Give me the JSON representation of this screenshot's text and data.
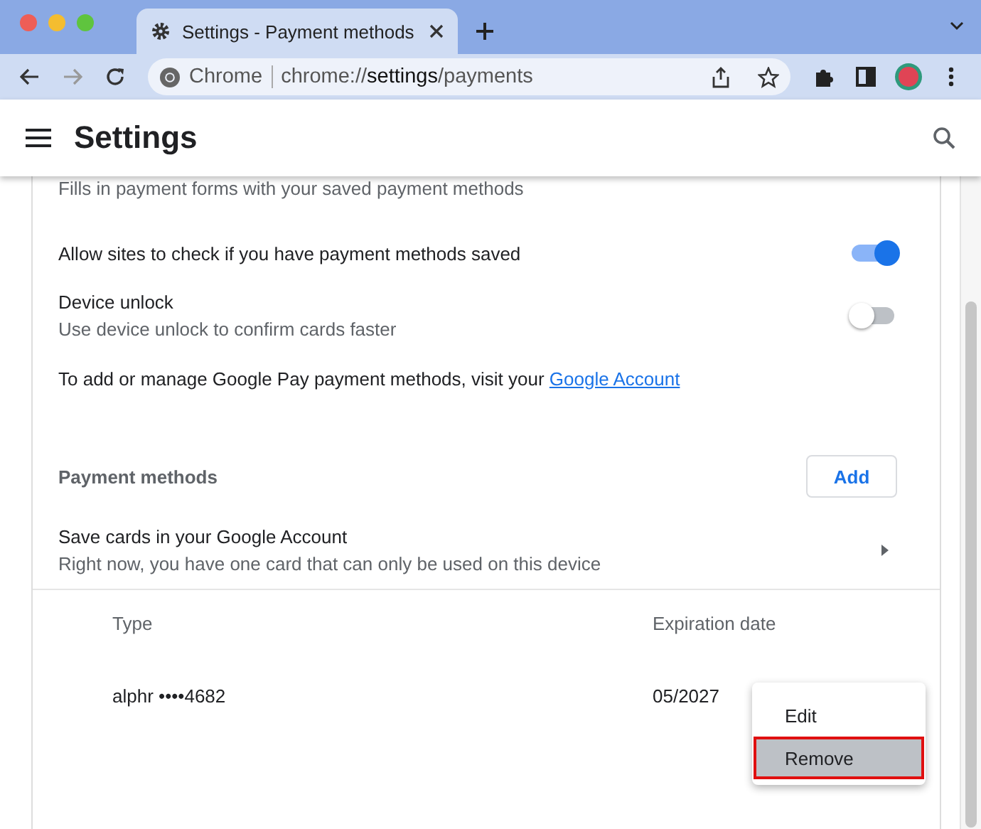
{
  "browser": {
    "tab_title": "Settings - Payment methods",
    "omnibox_label": "Chrome",
    "url_prefix": "chrome://",
    "url_host": "settings",
    "url_path": "/payments"
  },
  "header": {
    "title": "Settings"
  },
  "settings": {
    "cut_description": "Fills in payment forms with your saved payment methods",
    "toggles": [
      {
        "label": "Allow sites to check if you have payment methods saved",
        "on": true
      },
      {
        "label": "Device unlock",
        "description": "Use device unlock to confirm cards faster",
        "on": false
      }
    ],
    "google_pay_text": "To add or manage Google Pay payment methods, visit your",
    "google_pay_link": "Google Account",
    "section_title": "Payment methods",
    "add_button": "Add",
    "save_cards": {
      "title": "Save cards in your Google Account",
      "description": "Right now, you have one card that can only be used on this device"
    },
    "columns": [
      "Type",
      "Expiration date"
    ],
    "cards": [
      {
        "type": "alphr ••••4682",
        "expiration": "05/2027"
      }
    ]
  },
  "menu": [
    {
      "label": "Edit",
      "selected": false
    },
    {
      "label": "Remove",
      "selected": true
    }
  ]
}
